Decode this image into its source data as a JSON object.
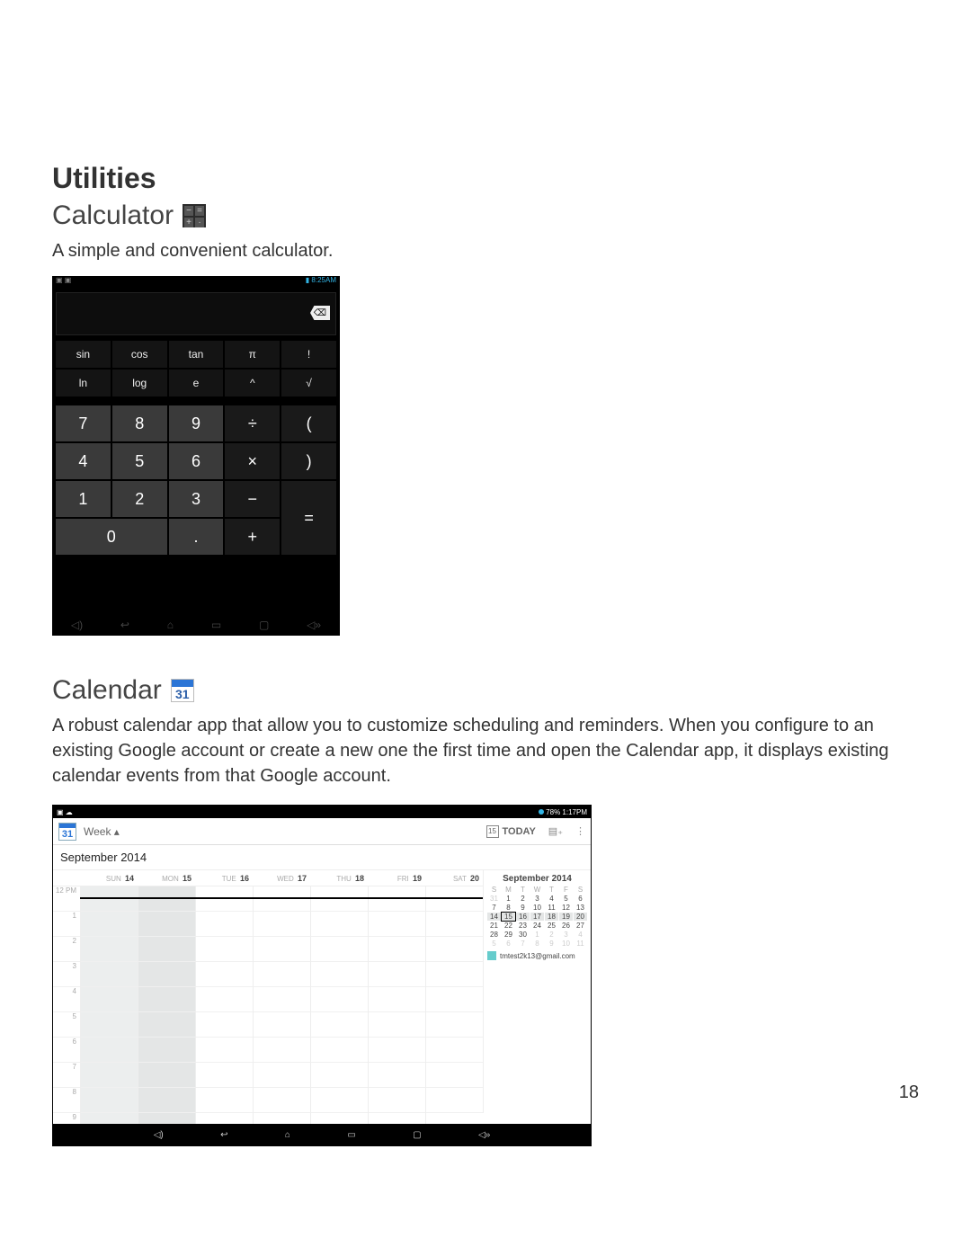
{
  "page_number": "18",
  "section_title": "Utilities",
  "calculator": {
    "title": "Calculator",
    "description": "A simple and convenient calculator.",
    "status_right": "8:25AM",
    "sci_row1": [
      "sin",
      "cos",
      "tan",
      "π",
      "!"
    ],
    "sci_row2": [
      "ln",
      "log",
      "e",
      "^",
      "√"
    ],
    "keys": {
      "n7": "7",
      "n8": "8",
      "n9": "9",
      "div": "÷",
      "lp": "(",
      "n4": "4",
      "n5": "5",
      "n6": "6",
      "mul": "×",
      "rp": ")",
      "n1": "1",
      "n2": "2",
      "n3": "3",
      "sub": "−",
      "eq": "=",
      "n0": "0",
      "dot": ".",
      "add": "+"
    },
    "backspace": "⌫"
  },
  "calendar": {
    "title": "Calendar",
    "icon_day": "31",
    "description": "A robust calendar app that allow you to customize scheduling and reminders. When you configure to an existing Google account or create a new one the first time and open the Calendar app, it displays existing calendar events from that Google account.",
    "status_left": "▣ ☁",
    "status_right_pct": "78%",
    "status_right_time": "1:17PM",
    "bar_icon_day": "31",
    "view_label": "Week ▴",
    "today_label": "TODAY",
    "today_num": "15",
    "month_label": "September 2014",
    "day_headers": [
      {
        "d": "SUN",
        "n": "14"
      },
      {
        "d": "MON",
        "n": "15"
      },
      {
        "d": "TUE",
        "n": "16"
      },
      {
        "d": "WED",
        "n": "17"
      },
      {
        "d": "THU",
        "n": "18"
      },
      {
        "d": "FRI",
        "n": "19"
      },
      {
        "d": "SAT",
        "n": "20"
      }
    ],
    "hours": [
      "12 PM",
      "1",
      "2",
      "3",
      "4",
      "5",
      "6",
      "7",
      "8",
      "9"
    ],
    "mini_title": "September 2014",
    "mini_dh": [
      "S",
      "M",
      "T",
      "W",
      "T",
      "F",
      "S"
    ],
    "mini_rows": [
      [
        {
          "v": "31",
          "m": 1
        },
        {
          "v": "1"
        },
        {
          "v": "2"
        },
        {
          "v": "3"
        },
        {
          "v": "4"
        },
        {
          "v": "5"
        },
        {
          "v": "6"
        }
      ],
      [
        {
          "v": "7"
        },
        {
          "v": "8"
        },
        {
          "v": "9"
        },
        {
          "v": "10"
        },
        {
          "v": "11"
        },
        {
          "v": "12"
        },
        {
          "v": "13"
        }
      ],
      [
        {
          "v": "14",
          "h": 1
        },
        {
          "v": "15",
          "s": 1,
          "h": 1
        },
        {
          "v": "16",
          "h": 1
        },
        {
          "v": "17",
          "h": 1
        },
        {
          "v": "18",
          "h": 1
        },
        {
          "v": "19",
          "h": 1
        },
        {
          "v": "20",
          "h": 1
        }
      ],
      [
        {
          "v": "21"
        },
        {
          "v": "22"
        },
        {
          "v": "23"
        },
        {
          "v": "24"
        },
        {
          "v": "25"
        },
        {
          "v": "26"
        },
        {
          "v": "27"
        }
      ],
      [
        {
          "v": "28"
        },
        {
          "v": "29"
        },
        {
          "v": "30"
        },
        {
          "v": "1",
          "m": 1
        },
        {
          "v": "2",
          "m": 1
        },
        {
          "v": "3",
          "m": 1
        },
        {
          "v": "4",
          "m": 1
        }
      ],
      [
        {
          "v": "5",
          "m": 1
        },
        {
          "v": "6",
          "m": 1
        },
        {
          "v": "7",
          "m": 1
        },
        {
          "v": "8",
          "m": 1
        },
        {
          "v": "9",
          "m": 1
        },
        {
          "v": "10",
          "m": 1
        },
        {
          "v": "11",
          "m": 1
        }
      ]
    ],
    "account": "tmtest2k13@gmail.com"
  }
}
